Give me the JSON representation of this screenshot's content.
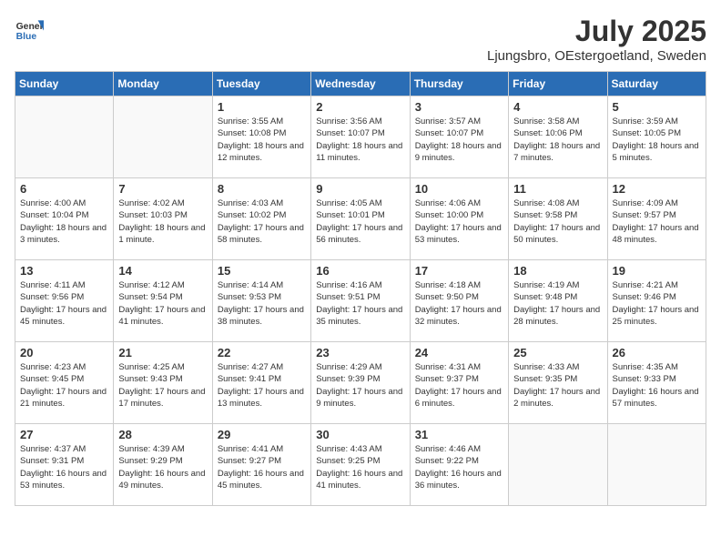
{
  "header": {
    "logo_general": "General",
    "logo_blue": "Blue",
    "month_title": "July 2025",
    "location": "Ljungsbro, OEstergoetland, Sweden"
  },
  "calendar": {
    "weekdays": [
      "Sunday",
      "Monday",
      "Tuesday",
      "Wednesday",
      "Thursday",
      "Friday",
      "Saturday"
    ],
    "weeks": [
      [
        {
          "day": "",
          "info": ""
        },
        {
          "day": "",
          "info": ""
        },
        {
          "day": "1",
          "info": "Sunrise: 3:55 AM\nSunset: 10:08 PM\nDaylight: 18 hours and 12 minutes."
        },
        {
          "day": "2",
          "info": "Sunrise: 3:56 AM\nSunset: 10:07 PM\nDaylight: 18 hours and 11 minutes."
        },
        {
          "day": "3",
          "info": "Sunrise: 3:57 AM\nSunset: 10:07 PM\nDaylight: 18 hours and 9 minutes."
        },
        {
          "day": "4",
          "info": "Sunrise: 3:58 AM\nSunset: 10:06 PM\nDaylight: 18 hours and 7 minutes."
        },
        {
          "day": "5",
          "info": "Sunrise: 3:59 AM\nSunset: 10:05 PM\nDaylight: 18 hours and 5 minutes."
        }
      ],
      [
        {
          "day": "6",
          "info": "Sunrise: 4:00 AM\nSunset: 10:04 PM\nDaylight: 18 hours and 3 minutes."
        },
        {
          "day": "7",
          "info": "Sunrise: 4:02 AM\nSunset: 10:03 PM\nDaylight: 18 hours and 1 minute."
        },
        {
          "day": "8",
          "info": "Sunrise: 4:03 AM\nSunset: 10:02 PM\nDaylight: 17 hours and 58 minutes."
        },
        {
          "day": "9",
          "info": "Sunrise: 4:05 AM\nSunset: 10:01 PM\nDaylight: 17 hours and 56 minutes."
        },
        {
          "day": "10",
          "info": "Sunrise: 4:06 AM\nSunset: 10:00 PM\nDaylight: 17 hours and 53 minutes."
        },
        {
          "day": "11",
          "info": "Sunrise: 4:08 AM\nSunset: 9:58 PM\nDaylight: 17 hours and 50 minutes."
        },
        {
          "day": "12",
          "info": "Sunrise: 4:09 AM\nSunset: 9:57 PM\nDaylight: 17 hours and 48 minutes."
        }
      ],
      [
        {
          "day": "13",
          "info": "Sunrise: 4:11 AM\nSunset: 9:56 PM\nDaylight: 17 hours and 45 minutes."
        },
        {
          "day": "14",
          "info": "Sunrise: 4:12 AM\nSunset: 9:54 PM\nDaylight: 17 hours and 41 minutes."
        },
        {
          "day": "15",
          "info": "Sunrise: 4:14 AM\nSunset: 9:53 PM\nDaylight: 17 hours and 38 minutes."
        },
        {
          "day": "16",
          "info": "Sunrise: 4:16 AM\nSunset: 9:51 PM\nDaylight: 17 hours and 35 minutes."
        },
        {
          "day": "17",
          "info": "Sunrise: 4:18 AM\nSunset: 9:50 PM\nDaylight: 17 hours and 32 minutes."
        },
        {
          "day": "18",
          "info": "Sunrise: 4:19 AM\nSunset: 9:48 PM\nDaylight: 17 hours and 28 minutes."
        },
        {
          "day": "19",
          "info": "Sunrise: 4:21 AM\nSunset: 9:46 PM\nDaylight: 17 hours and 25 minutes."
        }
      ],
      [
        {
          "day": "20",
          "info": "Sunrise: 4:23 AM\nSunset: 9:45 PM\nDaylight: 17 hours and 21 minutes."
        },
        {
          "day": "21",
          "info": "Sunrise: 4:25 AM\nSunset: 9:43 PM\nDaylight: 17 hours and 17 minutes."
        },
        {
          "day": "22",
          "info": "Sunrise: 4:27 AM\nSunset: 9:41 PM\nDaylight: 17 hours and 13 minutes."
        },
        {
          "day": "23",
          "info": "Sunrise: 4:29 AM\nSunset: 9:39 PM\nDaylight: 17 hours and 9 minutes."
        },
        {
          "day": "24",
          "info": "Sunrise: 4:31 AM\nSunset: 9:37 PM\nDaylight: 17 hours and 6 minutes."
        },
        {
          "day": "25",
          "info": "Sunrise: 4:33 AM\nSunset: 9:35 PM\nDaylight: 17 hours and 2 minutes."
        },
        {
          "day": "26",
          "info": "Sunrise: 4:35 AM\nSunset: 9:33 PM\nDaylight: 16 hours and 57 minutes."
        }
      ],
      [
        {
          "day": "27",
          "info": "Sunrise: 4:37 AM\nSunset: 9:31 PM\nDaylight: 16 hours and 53 minutes."
        },
        {
          "day": "28",
          "info": "Sunrise: 4:39 AM\nSunset: 9:29 PM\nDaylight: 16 hours and 49 minutes."
        },
        {
          "day": "29",
          "info": "Sunrise: 4:41 AM\nSunset: 9:27 PM\nDaylight: 16 hours and 45 minutes."
        },
        {
          "day": "30",
          "info": "Sunrise: 4:43 AM\nSunset: 9:25 PM\nDaylight: 16 hours and 41 minutes."
        },
        {
          "day": "31",
          "info": "Sunrise: 4:46 AM\nSunset: 9:22 PM\nDaylight: 16 hours and 36 minutes."
        },
        {
          "day": "",
          "info": ""
        },
        {
          "day": "",
          "info": ""
        }
      ]
    ]
  }
}
